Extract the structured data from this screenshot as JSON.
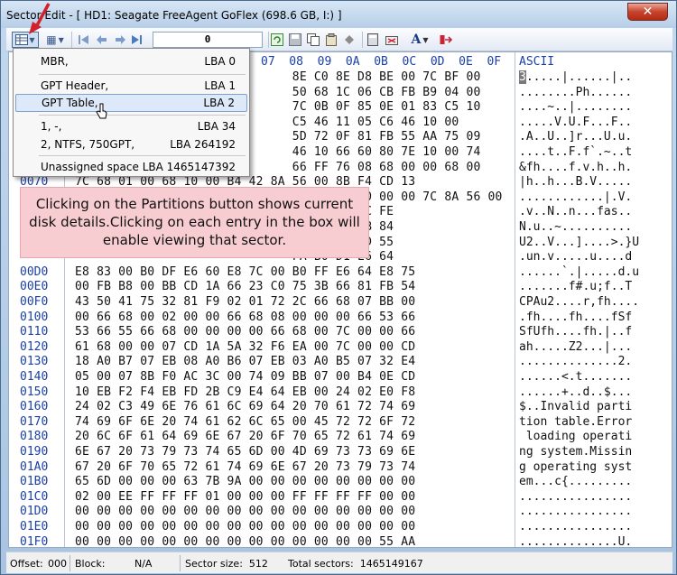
{
  "window": {
    "title": "Sector Edit - [ HD1: Seagate FreeAgent GoFlex (698.6 GB, I:) ]",
    "close_glyph": "✕"
  },
  "toolbar": {
    "sector_value": "0",
    "font_glyph": "A",
    "grid_glyph": "▦"
  },
  "hex_header": {
    "visible_cols": [
      "07",
      "08",
      "09",
      "0A",
      "0B",
      "0C",
      "0D",
      "0E",
      "0F"
    ],
    "ascii_label": "ASCII"
  },
  "rows": [
    {
      "off": "",
      "hex": "                              8E C0 8E D8 BE 00 7C BF 00",
      "asc": "3.....|......|.."
    },
    {
      "off": "",
      "hex": "                              50 68 1C 06 CB FB B9 04 00",
      "asc": "........Ph......"
    },
    {
      "off": "",
      "hex": "                              7C 0B 0F 85 0E 01 83 C5 10",
      "asc": "....~..|........"
    },
    {
      "off": "",
      "hex": "                              C5 46 11 05 C6 46 10 00",
      "asc": ".....V.U.F...F.."
    },
    {
      "off": "",
      "hex": "                              5D 72 0F 81 FB 55 AA 75 09",
      "asc": ".A..U..]r...U.u."
    },
    {
      "off": "",
      "hex": "                              46 10 66 60 80 7E 10 00 74",
      "asc": "....t..F.f`.~..t"
    },
    {
      "off": "",
      "hex": "                              66 FF 76 08 68 00 00 68 00",
      "asc": "&fh....f.v.h..h."
    },
    {
      "off": "0070",
      "hex": "7C 68 01 00 68 10 00 B4 42 8A 56 00 8B F4 CD 13",
      "asc": "|h..h...B.V....."
    },
    {
      "off": "",
      "hex": "                              00 00 00 00 00 00 7C 8A 56 00",
      "asc": "............|.V."
    },
    {
      "off": "",
      "hex": "                              66 61 73 1C FE",
      "asc": ".v..N..n...fas.."
    },
    {
      "off": "",
      "hex": "                              00 B2 80 EB 84",
      "asc": "N.u..~.........."
    },
    {
      "off": "",
      "hex": "                              81 3E FE 7D 55",
      "asc": "U2..V...]....>.}U"
    },
    {
      "off": "",
      "hex": "                              FA B0 D1 E6 64",
      "asc": ".un.v.....u....d"
    },
    {
      "off": "00D0",
      "hex": "E8 83 00 B0 DF E6 60 E8 7C 00 B0 FF E6 64 E8 75",
      "asc": "......`.|.....d.u"
    },
    {
      "off": "00E0",
      "hex": "00 FB B8 00 BB CD 1A 66 23 C0 75 3B 66 81 FB 54",
      "asc": ".......f#.u;f..T"
    },
    {
      "off": "00F0",
      "hex": "43 50 41 75 32 81 F9 02 01 72 2C 66 68 07 BB 00",
      "asc": "CPAu2....r,fh...."
    },
    {
      "off": "0100",
      "hex": "00 66 68 00 02 00 00 66 68 08 00 00 00 66 53 66",
      "asc": ".fh....fh....fSf"
    },
    {
      "off": "0110",
      "hex": "53 66 55 66 68 00 00 00 00 66 68 00 7C 00 00 66",
      "asc": "SfUfh....fh.|..f"
    },
    {
      "off": "0120",
      "hex": "61 68 00 00 07 CD 1A 5A 32 F6 EA 00 7C 00 00 CD",
      "asc": "ah.....Z2...|..."
    },
    {
      "off": "0130",
      "hex": "18 A0 B7 07 EB 08 A0 B6 07 EB 03 A0 B5 07 32 E4",
      "asc": "..............2."
    },
    {
      "off": "0140",
      "hex": "05 00 07 8B F0 AC 3C 00 74 09 BB 07 00 B4 0E CD",
      "asc": "......<.t......."
    },
    {
      "off": "0150",
      "hex": "10 EB F2 F4 EB FD 2B C9 E4 64 EB 00 24 02 E0 F8",
      "asc": "......+..d..$..."
    },
    {
      "off": "0160",
      "hex": "24 02 C3 49 6E 76 61 6C 69 64 20 70 61 72 74 69",
      "asc": "$..Invalid parti"
    },
    {
      "off": "0170",
      "hex": "74 69 6F 6E 20 74 61 62 6C 65 00 45 72 72 6F 72",
      "asc": "tion table.Error"
    },
    {
      "off": "0180",
      "hex": "20 6C 6F 61 64 69 6E 67 20 6F 70 65 72 61 74 69",
      "asc": " loading operati"
    },
    {
      "off": "0190",
      "hex": "6E 67 20 73 79 73 74 65 6D 00 4D 69 73 73 69 6E",
      "asc": "ng system.Missin"
    },
    {
      "off": "01A0",
      "hex": "67 20 6F 70 65 72 61 74 69 6E 67 20 73 79 73 74",
      "asc": "g operating syst"
    },
    {
      "off": "01B0",
      "hex": "65 6D 00 00 00 63 7B 9A 00 00 00 00 00 00 00 00",
      "asc": "em...c{........."
    },
    {
      "off": "01C0",
      "hex": "02 00 EE FF FF FF 01 00 00 00 FF FF FF FF 00 00",
      "asc": "................"
    },
    {
      "off": "01D0",
      "hex": "00 00 00 00 00 00 00 00 00 00 00 00 00 00 00 00",
      "asc": "................"
    },
    {
      "off": "01E0",
      "hex": "00 00 00 00 00 00 00 00 00 00 00 00 00 00 00 00",
      "asc": "................"
    },
    {
      "off": "01F0",
      "hex": "00 00 00 00 00 00 00 00 00 00 00 00 00 00 55 AA",
      "asc": "..............U."
    }
  ],
  "dropdown": {
    "items": [
      {
        "name": "MBR,",
        "lba": "LBA 0"
      },
      {
        "name": "GPT Header,",
        "lba": "LBA 1"
      },
      {
        "name": "GPT Table,",
        "lba": "LBA 2"
      },
      {
        "name": "1, -,",
        "lba": "LBA 34"
      },
      {
        "name": "2, NTFS, 750GPT,",
        "lba": "LBA 264192"
      },
      {
        "name": "Unassigned space",
        "lba": "LBA 1465147392"
      }
    ]
  },
  "annotation": {
    "text": "Clicking on the Partitions button shows current disk details.Clicking on each entry in the box will enable viewing that sector."
  },
  "status": {
    "offset_label": "Offset:",
    "offset_value": "000",
    "block_label": "Block:",
    "block_value": "N/A",
    "sector_size": "Sector size:  512",
    "total_sectors": "Total sectors:  1465149167"
  },
  "colors": {
    "accent": "#1a3fa8",
    "annotation_bg": "#f8cdd1",
    "highlight": "#dde9f8",
    "arrow": "#d3212b"
  }
}
